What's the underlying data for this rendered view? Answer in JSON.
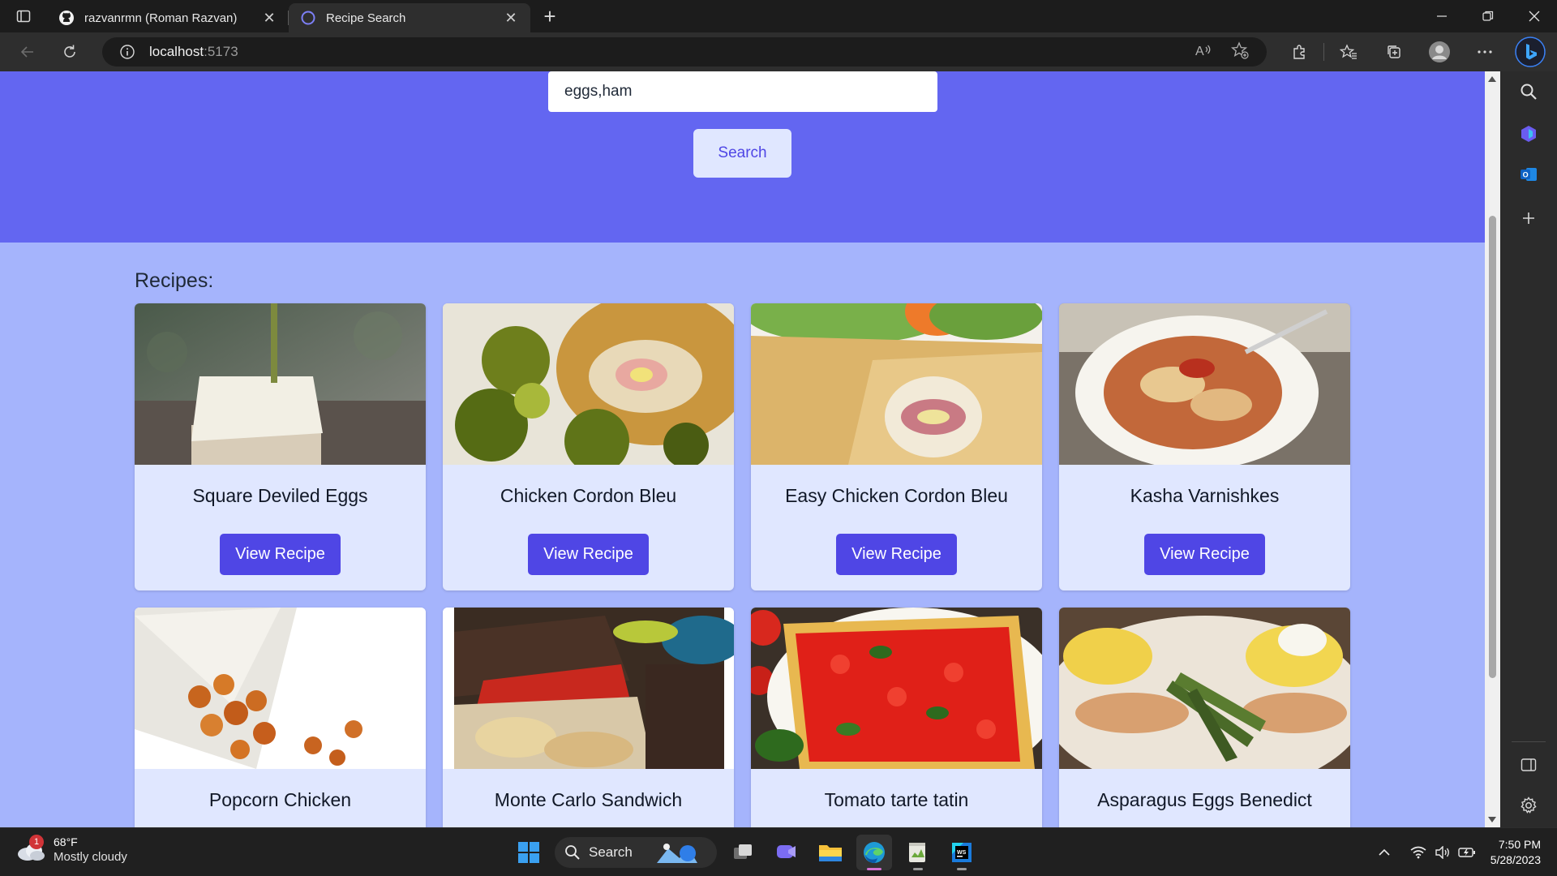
{
  "browser": {
    "tabs": [
      {
        "title": "razvanrmn (Roman Razvan)",
        "icon": "github-icon",
        "active": false
      },
      {
        "title": "Recipe Search",
        "icon": "loading-icon",
        "active": true
      }
    ],
    "address": {
      "host": "localhost",
      "port": ":5173"
    }
  },
  "page": {
    "search": {
      "value": "eggs,ham",
      "button_label": "Search"
    },
    "recipes_heading": "Recipes:",
    "view_button_label": "View Recipe",
    "recipes": [
      {
        "name": "Square Deviled Eggs",
        "image_theme": "white-cube-on-toothpick"
      },
      {
        "name": "Chicken Cordon Bleu",
        "image_theme": "breaded-chicken-brussels-sprouts"
      },
      {
        "name": "Easy Chicken Cordon Bleu",
        "image_theme": "breaded-chicken-ham-salad"
      },
      {
        "name": "Kasha Varnishkes",
        "image_theme": "bowtie-pasta-plate"
      },
      {
        "name": "Popcorn Chicken",
        "image_theme": "fried-bites-paper-cone"
      },
      {
        "name": "Monte Carlo Sandwich",
        "image_theme": "dark-bread-sandwich-chips"
      },
      {
        "name": "Tomato tarte tatin",
        "image_theme": "tomato-tart-basil"
      },
      {
        "name": "Asparagus Eggs Benedict",
        "image_theme": "asparagus-hollandaise"
      }
    ],
    "colors": {
      "hero": "#6366f1",
      "background": "#a5b4fc",
      "card": "#e0e7ff",
      "button": "#4f46e5"
    }
  },
  "taskbar": {
    "weather": {
      "temp": "68°F",
      "condition": "Mostly cloudy",
      "badge": "1"
    },
    "search_label": "Search",
    "time": "7:50 PM",
    "date": "5/28/2023"
  }
}
